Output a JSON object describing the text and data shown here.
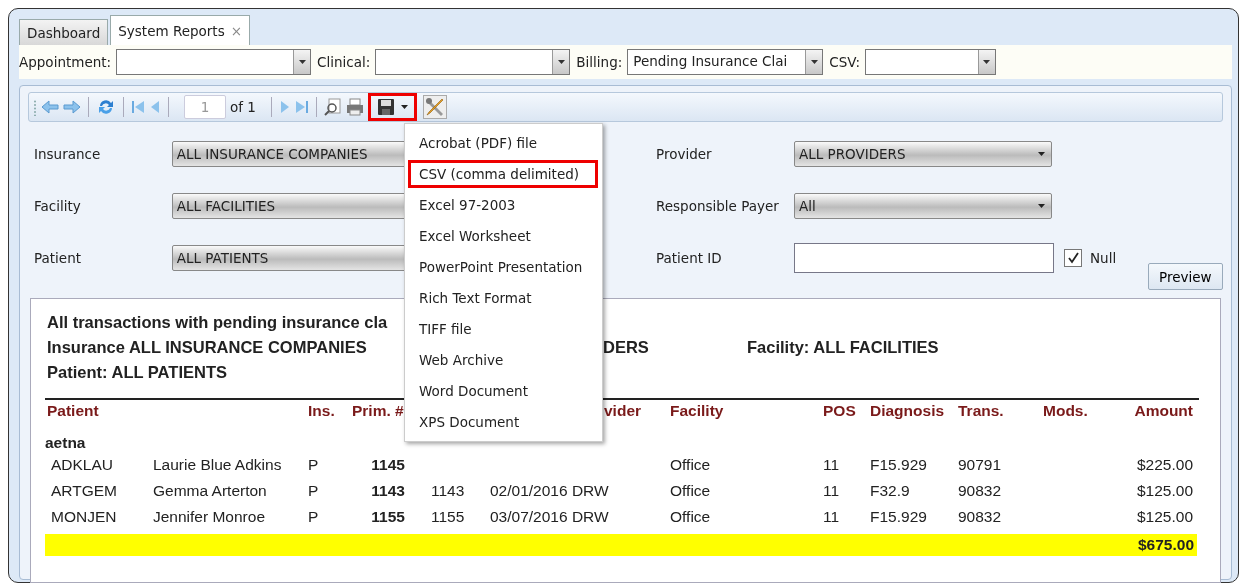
{
  "tabs": [
    {
      "label": "Dashboard",
      "selected": false,
      "closable": false
    },
    {
      "label": "System Reports",
      "selected": true,
      "closable": true,
      "close": "×"
    }
  ],
  "filters": [
    {
      "label": "Appointment:"
    },
    {
      "label": "Clinical:"
    },
    {
      "label": "Billing:",
      "value": "Pending Insurance Clai"
    },
    {
      "label": "CSV:"
    }
  ],
  "toolbar": {
    "page": "1",
    "of": "of 1",
    "save_highlighted": true
  },
  "params_left": [
    {
      "label": "Insurance",
      "value": "ALL INSURANCE COMPANIES"
    },
    {
      "label": "Facility",
      "value": "ALL FACILITIES"
    },
    {
      "label": "Patient",
      "value": "ALL PATIENTS"
    }
  ],
  "params_right": [
    {
      "label": "Provider",
      "kind": "select",
      "value": "ALL PROVIDERS"
    },
    {
      "label": "Responsible Payer",
      "kind": "select",
      "value": "All"
    },
    {
      "label": "Patient ID",
      "kind": "input",
      "null_label": "Null",
      "null_checked": true
    }
  ],
  "preview_button": "Preview",
  "export_menu": [
    {
      "label": "Acrobat (PDF) file",
      "highlighted": false
    },
    {
      "label": "CSV (comma delimited)",
      "highlighted": true
    },
    {
      "label": "Excel 97-2003",
      "highlighted": false
    },
    {
      "label": "Excel Worksheet",
      "highlighted": false
    },
    {
      "label": "PowerPoint Presentation",
      "highlighted": false
    },
    {
      "label": "Rich Text Format",
      "highlighted": false
    },
    {
      "label": "TIFF file",
      "highlighted": false
    },
    {
      "label": "Web Archive",
      "highlighted": false
    },
    {
      "label": "Word Document",
      "highlighted": false
    },
    {
      "label": "XPS Document",
      "highlighted": false
    }
  ],
  "report": {
    "title": "All transactions with pending insurance cla",
    "insurance": "Insurance ALL INSURANCE COMPANIES",
    "provider_fragment": "DERS",
    "facility": "Facility: ALL FACILITIES",
    "patient": "Patient: ALL PATIENTS",
    "columns": [
      "Patient",
      "",
      "Ins.",
      "Prim. #",
      "",
      "vider",
      "Facility",
      "POS",
      "Diagnosis",
      "Trans.",
      "Mods.",
      "Amount"
    ],
    "group": "aetna",
    "rows": [
      {
        "cells": [
          "ADKLAU",
          "Laurie Blue Adkins",
          "P",
          "1145",
          null,
          null,
          "Office",
          "11",
          "F15.929",
          "90791",
          "",
          "$225.00"
        ]
      },
      {
        "cells": [
          "ARTGEM",
          "Gemma Arterton",
          "P",
          "1143",
          "1143",
          "02/01/2016 DRW",
          "Office",
          "11",
          "F32.9",
          "90832",
          "",
          "$125.00"
        ]
      },
      {
        "cells": [
          "MONJEN",
          "Jennifer Monroe",
          "P",
          "1155",
          "1155",
          "03/07/2016 DRW",
          "Office",
          "11",
          "F15.929",
          "90832",
          "",
          "$125.00"
        ]
      }
    ],
    "total": "$675.00"
  }
}
